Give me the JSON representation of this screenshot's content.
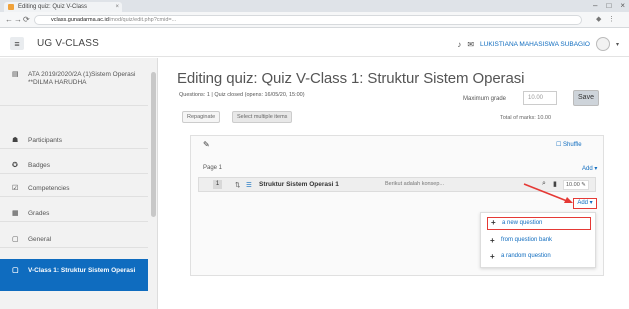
{
  "browser": {
    "tab_title": "Editing quiz: Quiz V-Class",
    "url_domain": "vclass.gunadarma.ac.id",
    "url_rest": "/mod/quiz/edit.php?cmid=...",
    "close_glyph": "×",
    "window_controls": [
      "–",
      "□",
      "×"
    ],
    "nav_glyphs": [
      "←",
      "→",
      "⟳"
    ]
  },
  "header": {
    "site_name": "UG V-CLASS",
    "menu_glyph": "≡",
    "username": "LUKISTIANA MAHASISWA SUBAGIO",
    "caret_glyph": "▾",
    "icons": [
      "bell-icon",
      "chat-icon"
    ]
  },
  "drawer": {
    "items": [
      {
        "label": "ATA 2019/2020/2A (1)Sistem Operasi **DILMA HARUDHA",
        "icon": "course-icon",
        "glyph": "▤"
      },
      {
        "label": "Participants",
        "icon": "users-icon",
        "glyph": "☗"
      },
      {
        "label": "Badges",
        "icon": "badge-icon",
        "glyph": "✪"
      },
      {
        "label": "Competencies",
        "icon": "check-icon",
        "glyph": "☑"
      },
      {
        "label": "Grades",
        "icon": "grades-icon",
        "glyph": "▦"
      },
      {
        "label": "General",
        "icon": "folder-icon",
        "glyph": "▢"
      },
      {
        "label": "V-Class 1: Struktur Sistem Operasi",
        "icon": "folder-icon",
        "glyph": "▢"
      }
    ]
  },
  "main": {
    "title": "Editing quiz: Quiz V-Class 1: Struktur Sistem Operasi",
    "info": "Questions: 1 | Quiz closed (opens: 16/05/20, 15:00)",
    "max_grade_label": "Maximum grade",
    "max_grade_value": "10.00",
    "save_label": "Save",
    "total_marks": "Total of marks: 10.00",
    "repaginate_label": "Repaginate",
    "select_multiple_label": "Select multiple items",
    "shuffle_label": "Shuffle",
    "page_label": "Page 1",
    "add_label": "Add ▾",
    "question": {
      "number": "1",
      "name": "Struktur Sistem Operasi 1",
      "text": "Berikut adalah konsep...",
      "mark": "10.00"
    },
    "add_menu": [
      "a new question",
      "from question bank",
      "a random question"
    ]
  },
  "colors": {
    "accent": "#0f6cbf",
    "highlight": "#e53935"
  }
}
